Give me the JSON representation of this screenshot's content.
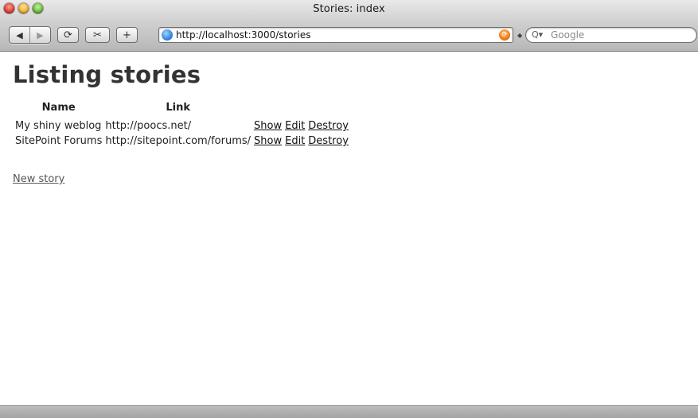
{
  "window": {
    "title": "Stories: index"
  },
  "toolbar": {
    "back_icon": "◀",
    "forward_icon": "▶",
    "reload_icon": "⟳",
    "snippet_icon": "✂",
    "add_icon": "+",
    "url": "http://localhost:3000/stories",
    "search_placeholder": "Google"
  },
  "page": {
    "heading": "Listing stories",
    "table": {
      "headers": [
        "Name",
        "Link"
      ],
      "rows": [
        {
          "name": "My shiny weblog",
          "link": "http://poocs.net/",
          "show": "Show",
          "edit": "Edit",
          "destroy": "Destroy"
        },
        {
          "name": "SitePoint Forums",
          "link": "http://sitepoint.com/forums/",
          "show": "Show",
          "edit": "Edit",
          "destroy": "Destroy"
        }
      ]
    },
    "new_story_link": "New story"
  }
}
